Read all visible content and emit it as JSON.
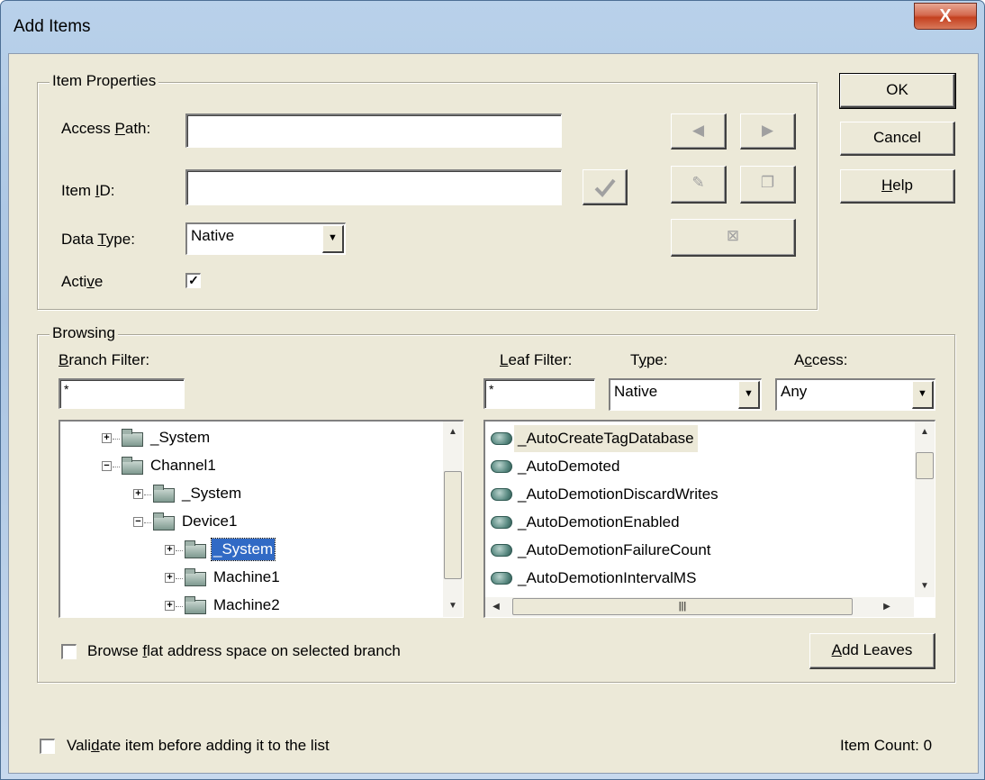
{
  "window": {
    "title": "Add Items",
    "close_glyph": "X"
  },
  "item_properties": {
    "legend": "Item Properties",
    "access_path_label": [
      "Access ",
      "P",
      "ath:"
    ],
    "access_path_value": "",
    "item_id_label": [
      "Item ",
      "I",
      "D:"
    ],
    "item_id_value": "",
    "data_type_label": [
      "Data ",
      "T",
      "ype:"
    ],
    "data_type_value": "Native",
    "active_label": [
      "Acti",
      "v",
      "e"
    ],
    "active_checked": true
  },
  "buttons": {
    "ok": "OK",
    "cancel": "Cancel",
    "help": [
      "",
      "H",
      "elp"
    ]
  },
  "browsing": {
    "legend": "Browsing",
    "branch_filter_label": [
      "",
      "B",
      "ranch Filter:"
    ],
    "branch_filter_value": "*",
    "leaf_filter_label": [
      "",
      "L",
      "eaf Filter:"
    ],
    "leaf_filter_value": "*",
    "type_label": [
      "T",
      "y",
      "pe:"
    ],
    "type_value": "Native",
    "access_label": [
      "A",
      "c",
      "cess:"
    ],
    "access_value": "Any",
    "tree": [
      {
        "label": "_System",
        "expander": "+",
        "depth": 0
      },
      {
        "label": "Channel1",
        "expander": "-",
        "depth": 0
      },
      {
        "label": "_System",
        "expander": "+",
        "depth": 1
      },
      {
        "label": "Device1",
        "expander": "-",
        "depth": 1
      },
      {
        "label": "_System",
        "expander": "+",
        "depth": 2,
        "selected": true
      },
      {
        "label": "Machine1",
        "expander": "+",
        "depth": 2
      },
      {
        "label": "Machine2",
        "expander": "+",
        "depth": 2
      }
    ],
    "leaves": [
      "_AutoCreateTagDatabase",
      "_AutoDemoted",
      "_AutoDemotionDiscardWrites",
      "_AutoDemotionEnabled",
      "_AutoDemotionFailureCount",
      "_AutoDemotionIntervalMS"
    ],
    "browse_flat_label": [
      "Browse ",
      "f",
      "lat address space on selected branch"
    ],
    "browse_flat_checked": false,
    "add_leaves": [
      "",
      "A",
      "dd Leaves"
    ]
  },
  "footer": {
    "validate_label": [
      "Vali",
      "d",
      "ate item before adding it to the list"
    ],
    "validate_checked": false,
    "item_count": "Item Count: 0"
  }
}
